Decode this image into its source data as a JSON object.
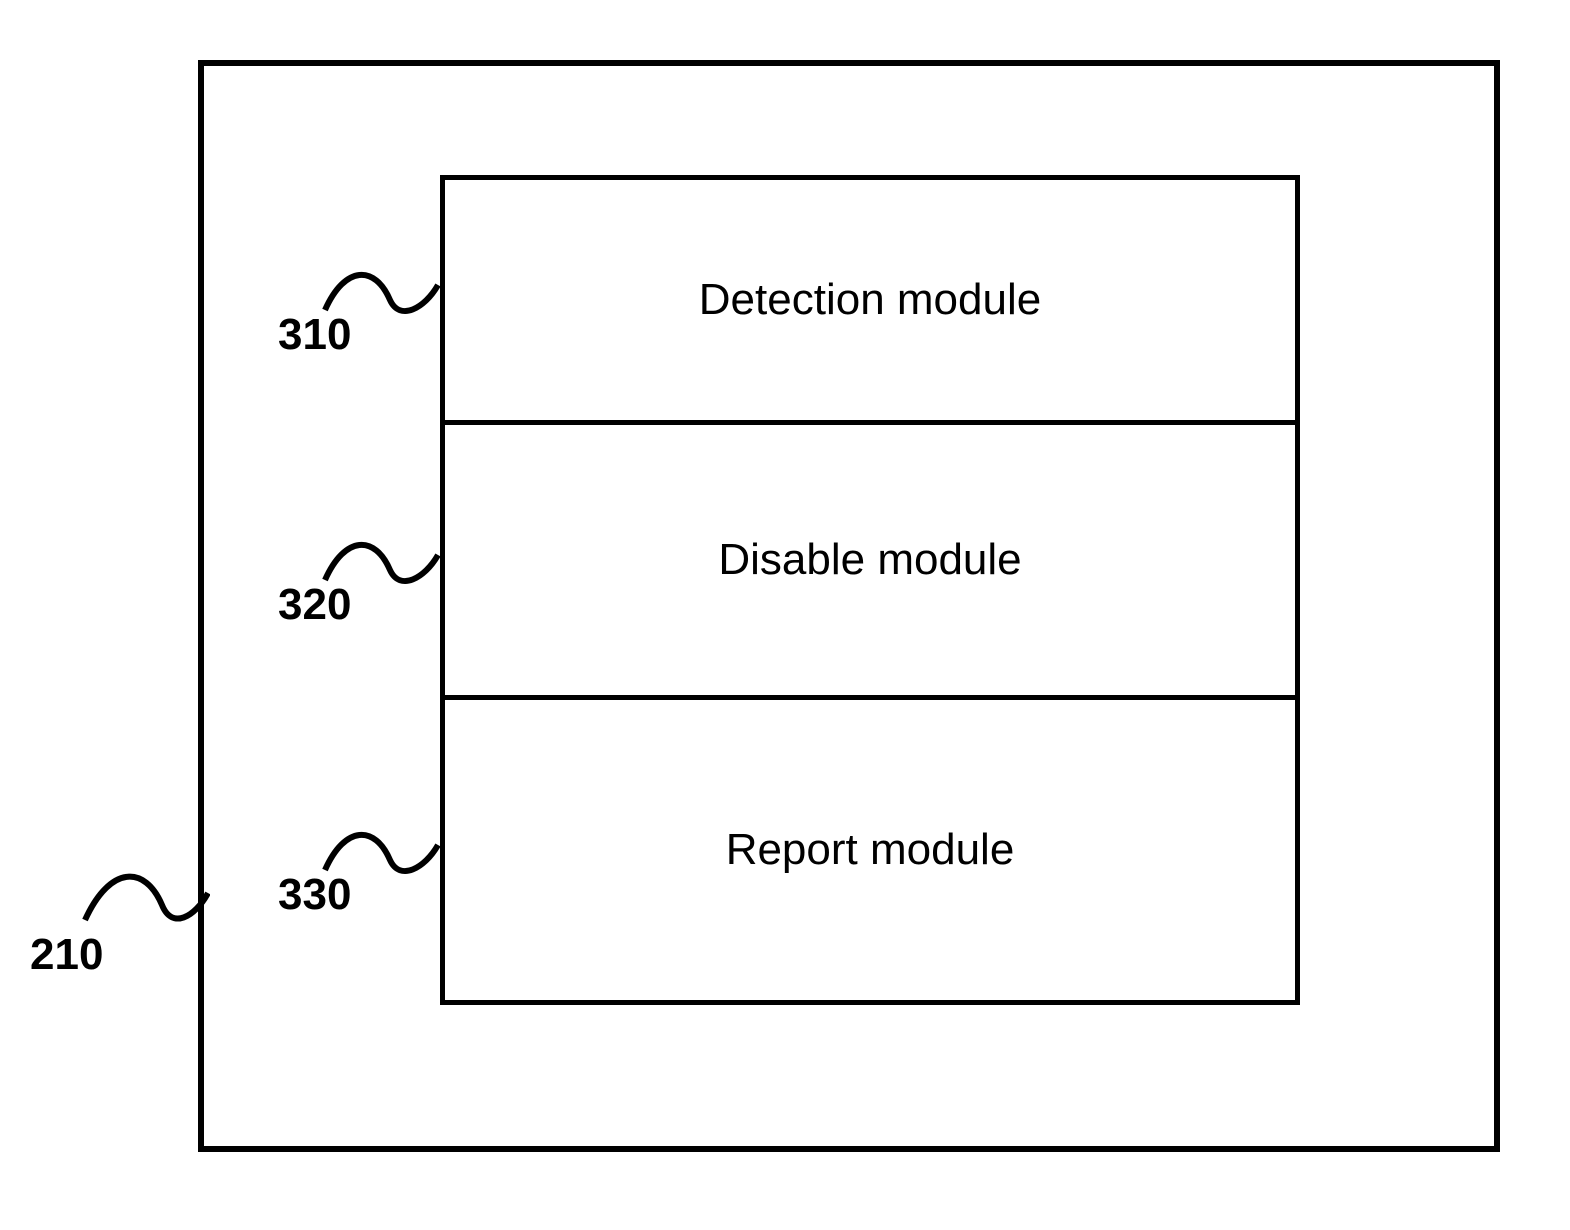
{
  "outer_ref": "210",
  "modules": [
    {
      "ref": "310",
      "label": "Detection module"
    },
    {
      "ref": "320",
      "label": "Disable module"
    },
    {
      "ref": "330",
      "label": "Report module"
    }
  ]
}
